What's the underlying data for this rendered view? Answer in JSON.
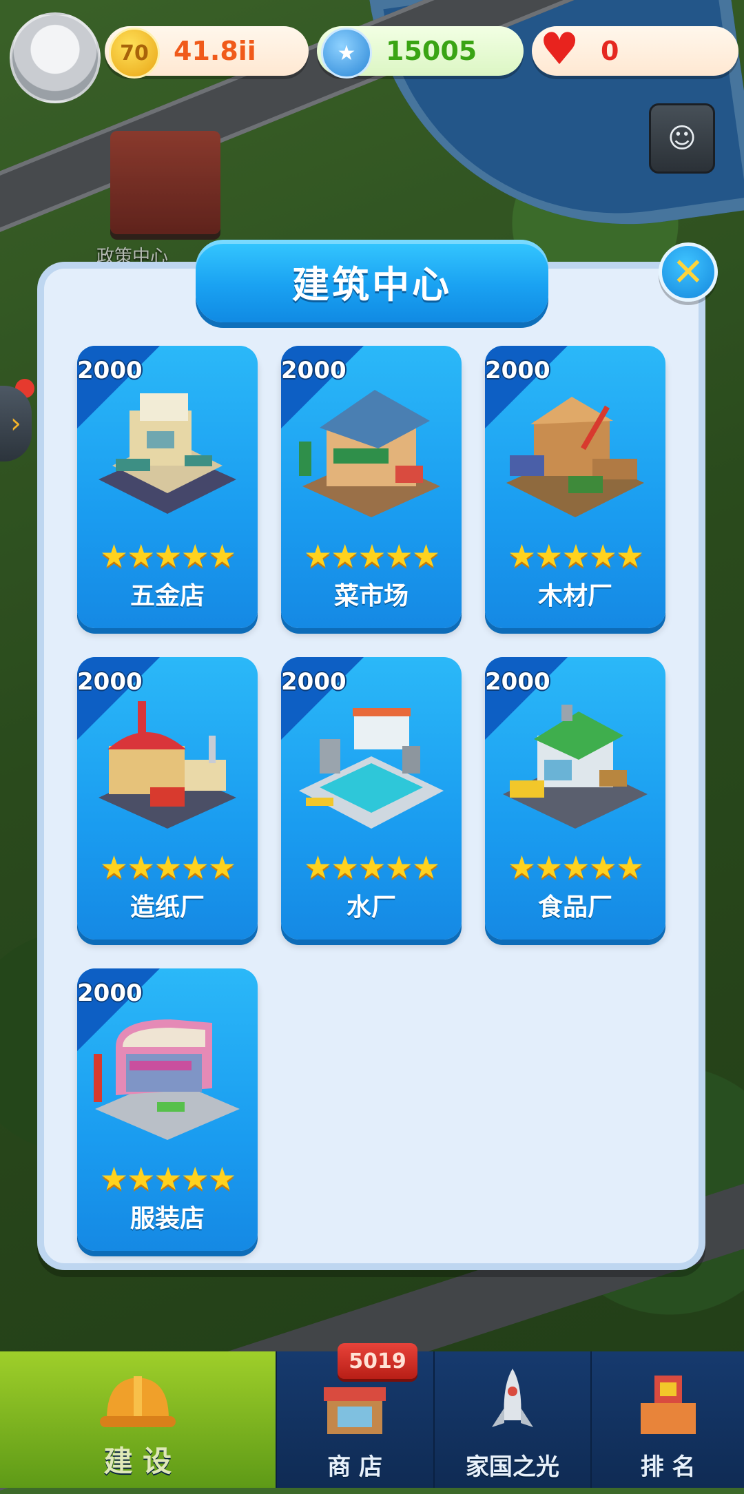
{
  "hud": {
    "gold": "41.8ii",
    "stars": "15005",
    "hearts": "0",
    "gold_icon_text": "70"
  },
  "map": {
    "policy_center_label": "政策中心"
  },
  "dialog": {
    "title": "建筑中心",
    "close_icon": "close-icon",
    "buildings": [
      {
        "name": "五金店",
        "price": "2000",
        "stars": "★★★★★"
      },
      {
        "name": "菜市场",
        "price": "2000",
        "stars": "★★★★★"
      },
      {
        "name": "木材厂",
        "price": "2000",
        "stars": "★★★★★"
      },
      {
        "name": "造纸厂",
        "price": "2000",
        "stars": "★★★★★"
      },
      {
        "name": "水厂",
        "price": "2000",
        "stars": "★★★★★"
      },
      {
        "name": "食品厂",
        "price": "2000",
        "stars": "★★★★★"
      },
      {
        "name": "服装店",
        "price": "2000",
        "stars": "★★★★★"
      }
    ]
  },
  "nav": {
    "build": "建 设",
    "shop": "商 店",
    "shop_badge": "5019",
    "home": "家国之光",
    "rank": "排 名"
  },
  "colors": {
    "accent": "#1a9cf0",
    "dialog_bg": "#e3eefb",
    "nav_active": "#7db521"
  }
}
